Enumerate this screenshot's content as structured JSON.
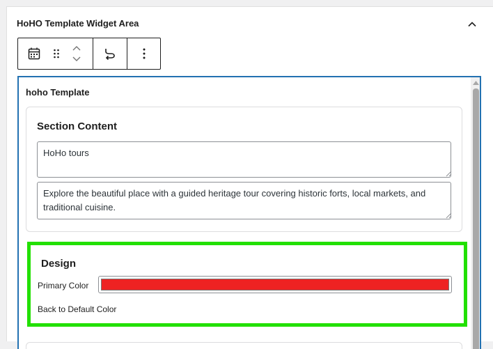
{
  "widget_area": {
    "title": "HoHO Template Widget Area",
    "collapse_icon": "chevron-up-icon"
  },
  "toolbar": {
    "block_icon": "calendar-icon",
    "drag_icon": "drag-handle-icon",
    "move_up_icon": "chevron-up-icon",
    "move_down_icon": "chevron-down-icon",
    "transform_icon": "transform-icon",
    "options_icon": "more-vertical-icon"
  },
  "widget": {
    "title": "hoho Template",
    "section_content": {
      "heading": "Section Content",
      "title_value": "HoHo tours",
      "description_value": "Explore the beautiful place with a guided heritage tour covering historic forts, local markets, and traditional cuisine."
    },
    "design": {
      "heading": "Design",
      "primary_color_label": "Primary Color",
      "primary_color_value": "#ee2222",
      "reset_label": "Back to Default Color"
    }
  },
  "colors": {
    "highlight_border": "#22e000",
    "selected_block_border": "#2271b1"
  }
}
